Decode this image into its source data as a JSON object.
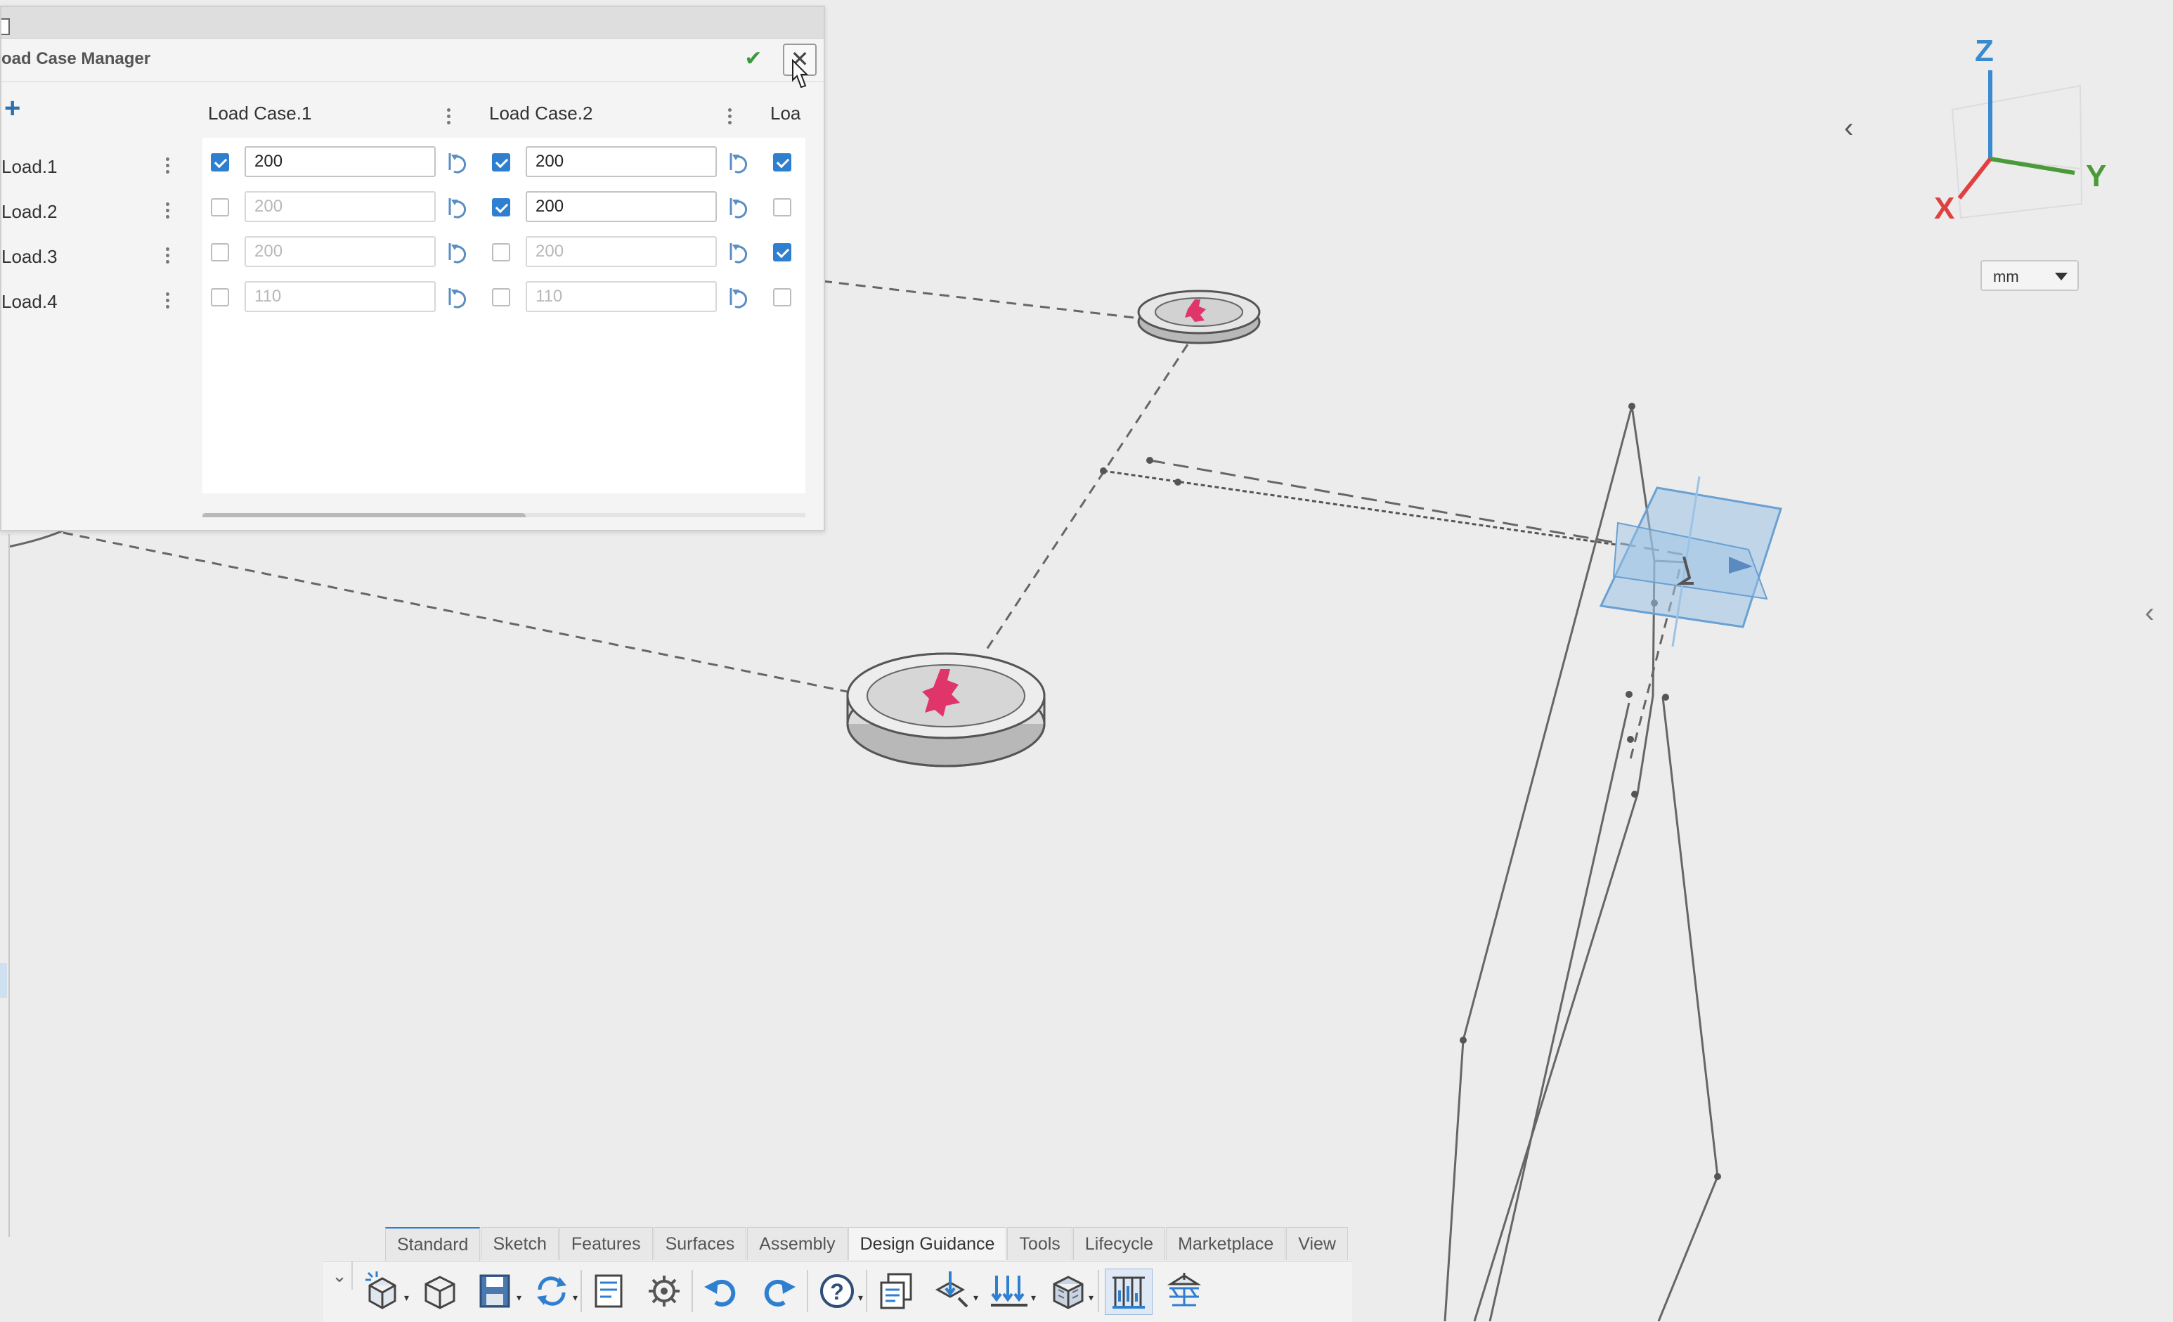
{
  "dialog": {
    "title": "oad Case Manager",
    "ok_icon": "check-icon",
    "close_icon": "close-icon",
    "add_icon": "plus-icon",
    "columns": [
      {
        "label": "Load Case.1"
      },
      {
        "label": "Load Case.2"
      },
      {
        "label": "Loa"
      }
    ],
    "rows": [
      {
        "label": "Load.1",
        "cells": [
          {
            "checked": true,
            "value": "200"
          },
          {
            "checked": true,
            "value": "200"
          },
          {
            "checked": true
          }
        ]
      },
      {
        "label": "Load.2",
        "cells": [
          {
            "checked": false,
            "value": "200"
          },
          {
            "checked": true,
            "value": "200"
          },
          {
            "checked": false
          }
        ]
      },
      {
        "label": "Load.3",
        "cells": [
          {
            "checked": false,
            "value": "200"
          },
          {
            "checked": false,
            "value": "200"
          },
          {
            "checked": true
          }
        ]
      },
      {
        "label": "Load.4",
        "cells": [
          {
            "checked": false,
            "value": "110"
          },
          {
            "checked": false,
            "value": "110"
          },
          {
            "checked": false
          }
        ]
      }
    ]
  },
  "orientation": {
    "axes": {
      "z": "Z",
      "y": "Y",
      "x": "X"
    },
    "units": "mm",
    "collapse_icon": "chevron-left-icon"
  },
  "toolbar": {
    "tabs": [
      "Standard",
      "Sketch",
      "Features",
      "Surfaces",
      "Assembly",
      "Design Guidance",
      "Tools",
      "Lifecycle",
      "Marketplace",
      "View"
    ],
    "active_tab": "Design Guidance",
    "icons": [
      "new-part-icon",
      "open-icon",
      "save-icon",
      "rebuild-icon",
      "properties-icon",
      "settings-icon",
      "undo-icon",
      "redo-icon",
      "help-icon",
      "load-case-manager-icon",
      "loads-icon",
      "supports-icon",
      "material-icon",
      "results-icon",
      "structure-icon"
    ]
  },
  "colors": {
    "accent": "#2f7fd1",
    "load_marker": "#e0356a",
    "axis_x": "#e04040",
    "axis_y": "#4a9a3a",
    "axis_z": "#3a8ad0"
  }
}
